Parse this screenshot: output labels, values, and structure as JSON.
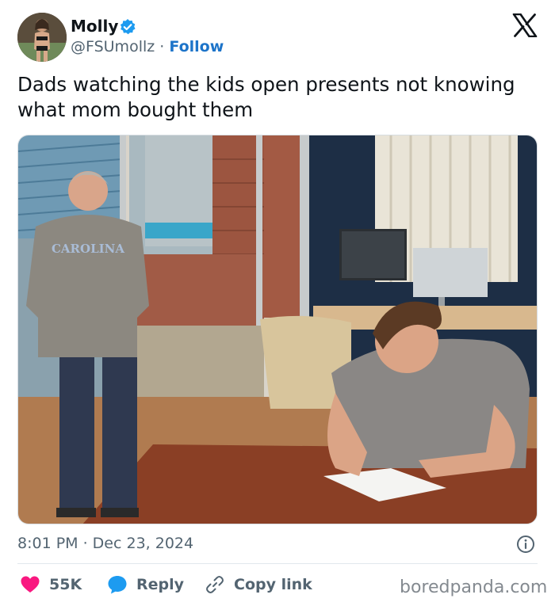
{
  "author": {
    "display_name": "Molly",
    "handle": "@FSUmollz",
    "separator": "·",
    "follow_label": "Follow",
    "verified_color": "#1d9bf0"
  },
  "tweet": {
    "text": "Dads watching the kids open presents not knowing what mom bought them",
    "photo": {
      "sweatshirt_text": "CAROLINA"
    },
    "timestamp": "8:01 PM · Dec 23, 2024"
  },
  "actions": {
    "like_count": "55K",
    "reply_label": "Reply",
    "copy_label": "Copy link"
  },
  "colors": {
    "like": "#f91880",
    "reply": "#1d9bf0",
    "link": "#1d74c9",
    "secondary_text": "#536471"
  },
  "icons": [
    "verified-badge-icon",
    "x-logo-icon",
    "info-icon",
    "heart-icon",
    "reply-bubble-icon",
    "link-icon"
  ],
  "watermark": "boredpanda.com"
}
